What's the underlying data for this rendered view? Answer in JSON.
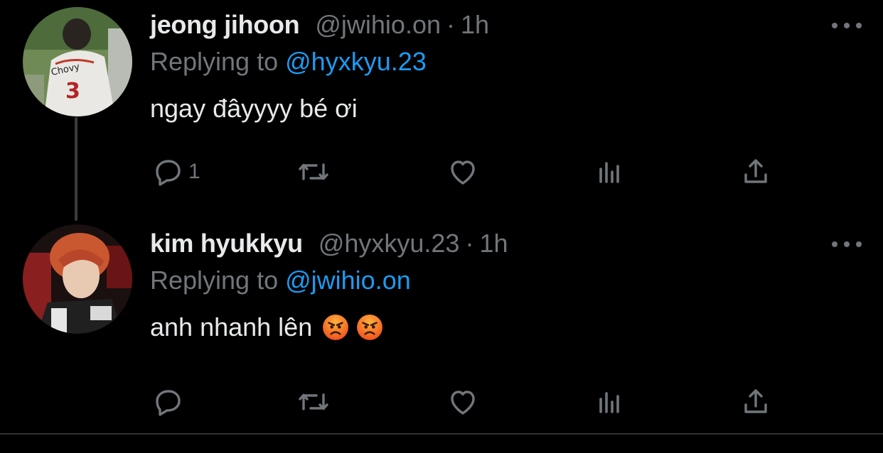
{
  "tweets": [
    {
      "name": "jeong jihoon",
      "handle": "@jwihio.on",
      "dot": "·",
      "time": "1h",
      "reply_prefix": "Replying to",
      "reply_to": "@hyxkyu.23",
      "text": "ngay đâyyyy bé ơi",
      "reply_count": "1",
      "avatar_jersey_text": "Chovy",
      "avatar_jersey_number": "3"
    },
    {
      "name": "kim hyukkyu",
      "handle": "@hyxkyu.23",
      "dot": "·",
      "time": "1h",
      "reply_prefix": "Replying to",
      "reply_to": "@jwihio.on",
      "text": "anh nhanh lên",
      "emojis": [
        "angry-face",
        "angry-face"
      ]
    }
  ],
  "colors": {
    "background": "#000000",
    "text": "#e7e9ea",
    "muted": "#71767b",
    "accent": "#1d9bf0",
    "thread_line": "#3a3d40"
  },
  "icons": [
    "more-icon",
    "reply-icon",
    "retweet-icon",
    "like-icon",
    "stats-icon",
    "share-icon"
  ]
}
